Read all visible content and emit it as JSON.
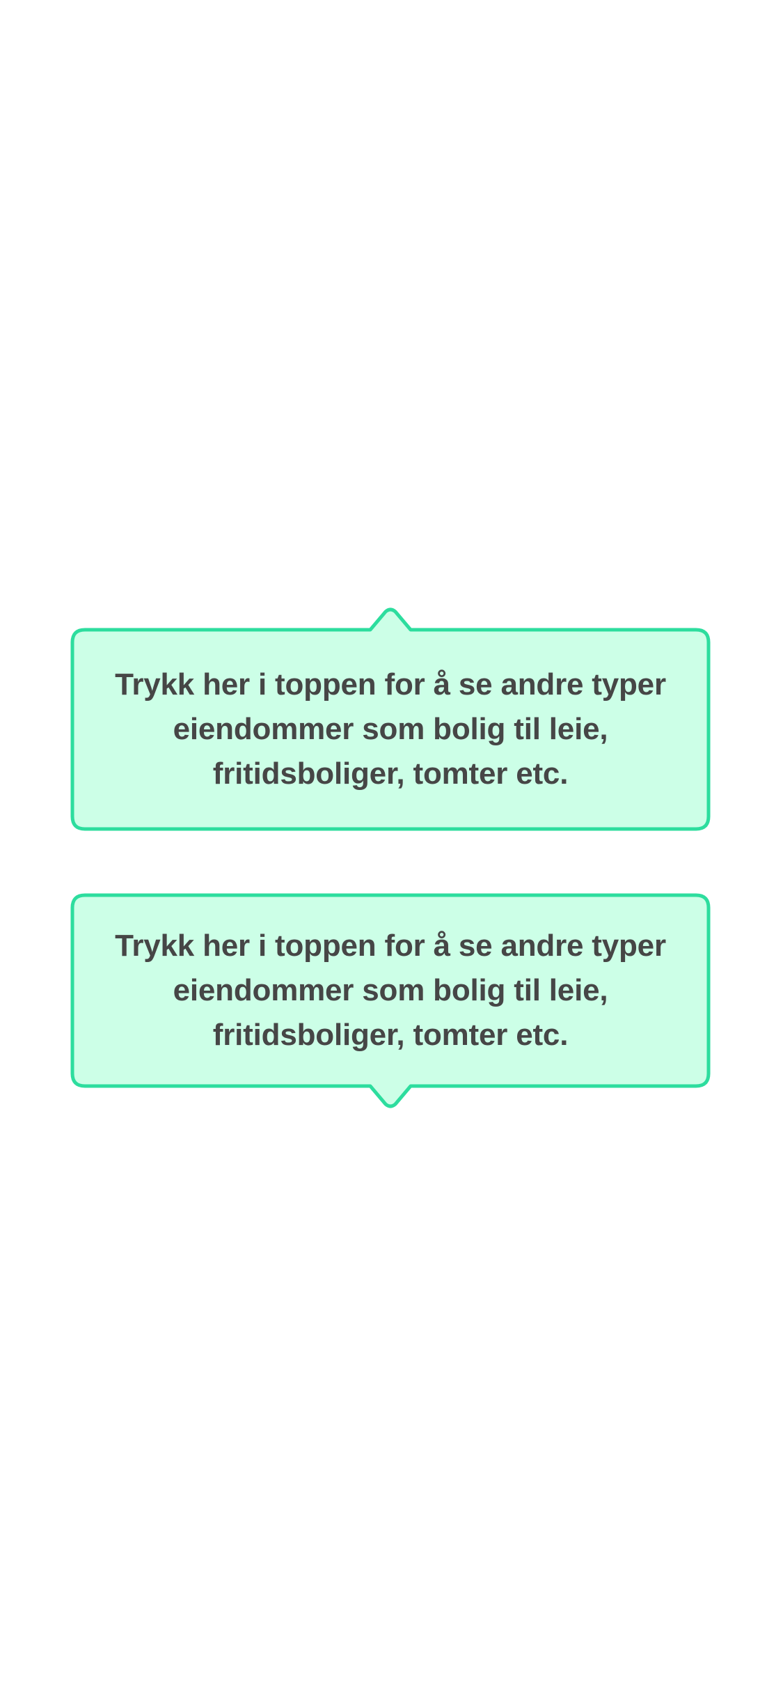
{
  "colors": {
    "background": "#ffffff",
    "callout_fill": "#ccffe7",
    "callout_border": "#2ddd9e",
    "text": "#464646"
  },
  "tooltips": [
    {
      "arrow": "up",
      "text": "Trykk her i toppen for å se andre typer eiendommer som bolig til leie, fritidsboliger, tomter etc."
    },
    {
      "arrow": "down",
      "text": "Trykk her i toppen for å se andre typer eiendommer som bolig til leie, fritidsboliger, tomter etc."
    }
  ]
}
